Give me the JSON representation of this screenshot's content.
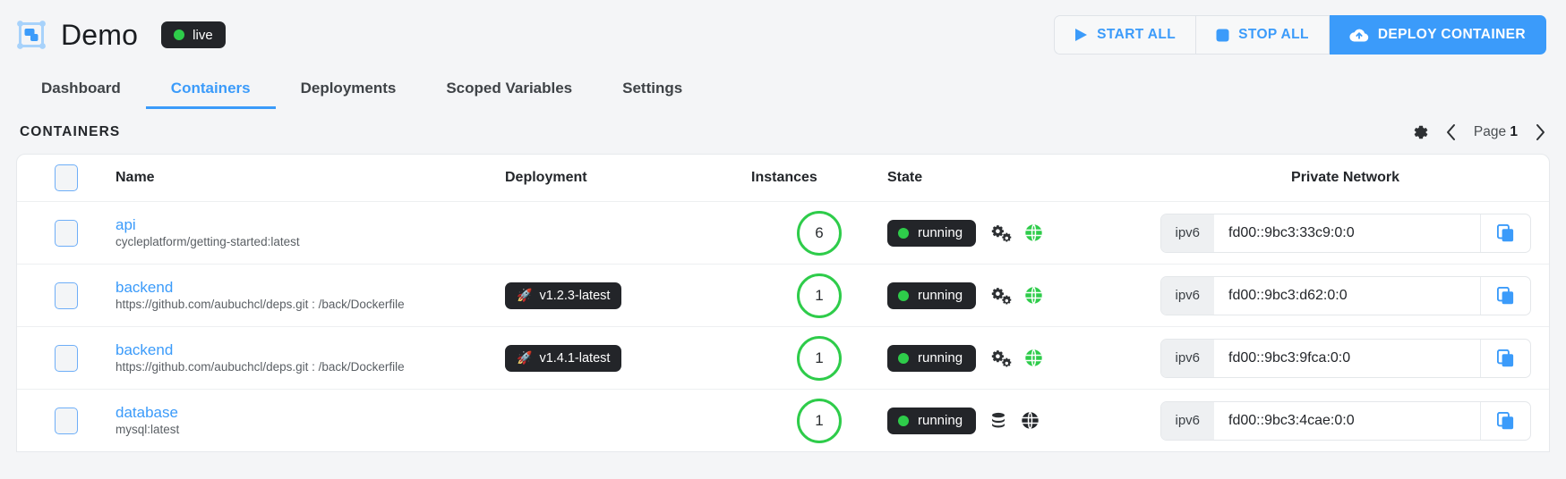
{
  "header": {
    "logo_icon": "containers-logo-icon",
    "title": "Demo",
    "status_badge": {
      "label": "live",
      "dot_color": "#2ecc4a"
    },
    "actions": [
      {
        "label": "START ALL",
        "icon": "play-icon",
        "style": "secondary"
      },
      {
        "label": "STOP ALL",
        "icon": "stop-square-icon",
        "style": "secondary"
      },
      {
        "label": "DEPLOY CONTAINER",
        "icon": "cloud-upload-icon",
        "style": "primary"
      }
    ]
  },
  "nav": {
    "tabs": [
      {
        "label": "Dashboard",
        "active": false
      },
      {
        "label": "Containers",
        "active": true
      },
      {
        "label": "Deployments",
        "active": false
      },
      {
        "label": "Scoped Variables",
        "active": false
      },
      {
        "label": "Settings",
        "active": false
      }
    ]
  },
  "section": {
    "title": "CONTAINERS",
    "settings_icon": "gear-icon",
    "prev_icon": "chevron-left-icon",
    "next_icon": "chevron-right-icon",
    "page_word": "Page",
    "page_number": "1"
  },
  "table": {
    "columns": {
      "name": "Name",
      "deployment": "Deployment",
      "instances": "Instances",
      "state": "State",
      "network": "Private Network"
    },
    "rows": [
      {
        "name": "api",
        "source": "cycleplatform/getting-started:latest",
        "deployment": "",
        "deployment_icon": "",
        "instances": "6",
        "state": "running",
        "state_icons": [
          "gears-icon",
          "globe-icon"
        ],
        "globe_color": "#2ecc4a",
        "network_proto": "ipv6",
        "network_address": "fd00::9bc3:33c9:0:0",
        "copy_icon": "copy-icon"
      },
      {
        "name": "backend",
        "source": "https://github.com/aubuchcl/deps.git : /back/Dockerfile",
        "deployment": "v1.2.3-latest",
        "deployment_icon": "rocket-icon",
        "instances": "1",
        "state": "running",
        "state_icons": [
          "gears-icon",
          "globe-icon"
        ],
        "globe_color": "#2ecc4a",
        "network_proto": "ipv6",
        "network_address": "fd00::9bc3:d62:0:0",
        "copy_icon": "copy-icon"
      },
      {
        "name": "backend",
        "source": "https://github.com/aubuchcl/deps.git : /back/Dockerfile",
        "deployment": "v1.4.1-latest",
        "deployment_icon": "rocket-icon",
        "instances": "1",
        "state": "running",
        "state_icons": [
          "gears-icon",
          "globe-icon"
        ],
        "globe_color": "#2ecc4a",
        "network_proto": "ipv6",
        "network_address": "fd00::9bc3:9fca:0:0",
        "copy_icon": "copy-icon"
      },
      {
        "name": "database",
        "source": "mysql:latest",
        "deployment": "",
        "deployment_icon": "",
        "instances": "1",
        "state": "running",
        "state_icons": [
          "database-icon",
          "globe-icon"
        ],
        "globe_color": "#23262a",
        "network_proto": "ipv6",
        "network_address": "fd00::9bc3:4cae:0:0",
        "copy_icon": "copy-icon"
      }
    ]
  },
  "colors": {
    "accent": "#3b9bfa",
    "success": "#2ecc4a",
    "dark": "#232529",
    "page_bg": "#f4f5f7"
  }
}
